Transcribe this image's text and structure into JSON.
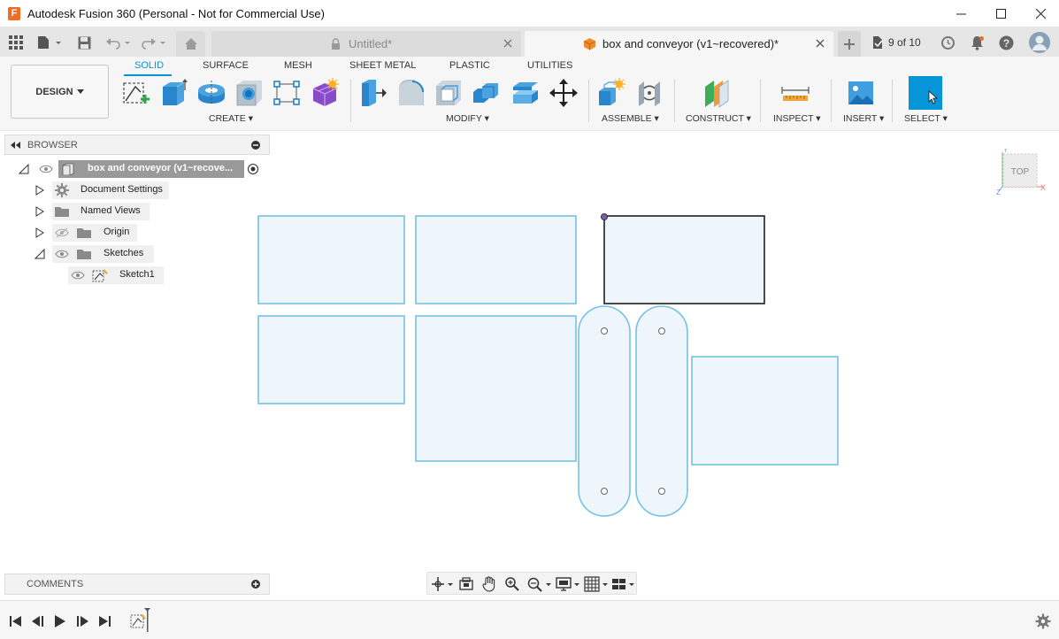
{
  "window": {
    "title": "Autodesk Fusion 360 (Personal - Not for Commercial Use)",
    "logo_letter": "F"
  },
  "tabs": {
    "untitled": "Untitled*",
    "active": "box and conveyor (v1~recovered)*",
    "page_counter": "9 of 10"
  },
  "toolbar": {
    "workspace": "DESIGN",
    "workspace_tabs": [
      "SOLID",
      "SURFACE",
      "MESH",
      "SHEET METAL",
      "PLASTIC",
      "UTILITIES"
    ],
    "groups": {
      "create": "CREATE",
      "modify": "MODIFY",
      "assemble": "ASSEMBLE",
      "construct": "CONSTRUCT",
      "inspect": "INSPECT",
      "insert": "INSERT",
      "select": "SELECT"
    }
  },
  "browser": {
    "title": "BROWSER",
    "root": "box and conveyor (v1~recove...",
    "items": {
      "document_settings": "Document Settings",
      "named_views": "Named Views",
      "origin": "Origin",
      "sketches": "Sketches",
      "sketch1": "Sketch1"
    }
  },
  "viewcube": {
    "face": "TOP",
    "axis_x": "X",
    "axis_y": "Y",
    "axis_z": "Z"
  },
  "comments": {
    "title": "COMMENTS"
  },
  "colors": {
    "accent": "#0696d7",
    "sketch_line": "#74c2e3",
    "sketch_fill": "#eef6fb",
    "selected_line": "#1f1f1f",
    "logo": "#f06c25"
  }
}
